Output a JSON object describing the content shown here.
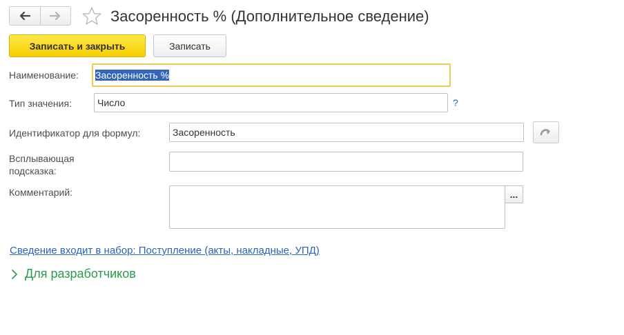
{
  "window": {
    "title": "Засоренность % (Дополнительное сведение)"
  },
  "toolbar": {
    "save_close_label": "Записать и закрыть",
    "save_label": "Записать"
  },
  "form": {
    "name_label": "Наименование:",
    "name_value": "Засоренность %",
    "type_label": "Тип значения:",
    "type_value": "Число",
    "type_help": "?",
    "identifier_label": "Идентификатор для формул:",
    "identifier_value": "Засоренность",
    "tooltip_label_line1": "Всплывающая",
    "tooltip_label_line2": "подсказка:",
    "tooltip_value": "",
    "comment_label": "Комментарий:",
    "comment_value": "",
    "comment_button": "..."
  },
  "links": {
    "set_link": "Сведение входит в набор: Поступление (акты, накладные, УПД)"
  },
  "groups": {
    "developers_label": "Для разработчиков"
  },
  "colors": {
    "primary_button": "#f5cf00",
    "focus_border": "#f2c94c",
    "link": "#2a63b8",
    "group_header": "#2b9a4a",
    "selection": "#3366bb"
  },
  "icons": {
    "back": "arrow-left-icon",
    "forward": "arrow-right-icon",
    "favorite": "star-outline-icon",
    "generate": "curved-arrow-icon",
    "expand": "chevron-right-icon"
  }
}
